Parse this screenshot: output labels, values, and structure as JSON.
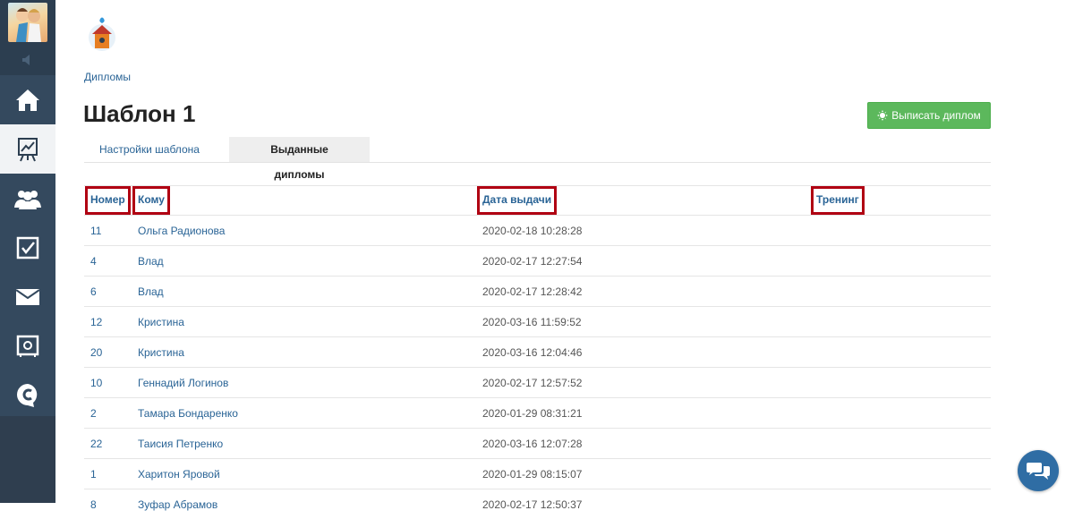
{
  "breadcrumb": "Дипломы",
  "page_title": "Шаблон 1",
  "issue_button_label": "Выписать диплом",
  "tabs": [
    {
      "label": "Настройки шаблона",
      "active": false
    },
    {
      "label": "Выданные дипломы",
      "active": true
    }
  ],
  "table": {
    "headers": [
      "Номер",
      "Кому",
      "Дата выдачи",
      "Тренинг"
    ],
    "rows": [
      {
        "num": "11",
        "to": "Ольга Радионова",
        "date": "2020-02-18 10:28:28",
        "training": ""
      },
      {
        "num": "4",
        "to": "Влад",
        "date": "2020-02-17 12:27:54",
        "training": ""
      },
      {
        "num": "6",
        "to": "Влад",
        "date": "2020-02-17 12:28:42",
        "training": ""
      },
      {
        "num": "12",
        "to": "Кристина",
        "date": "2020-03-16 11:59:52",
        "training": ""
      },
      {
        "num": "20",
        "to": "Кристина",
        "date": "2020-03-16 12:04:46",
        "training": ""
      },
      {
        "num": "10",
        "to": "Геннадий Логинов",
        "date": "2020-02-17 12:57:52",
        "training": ""
      },
      {
        "num": "2",
        "to": "Тамара Бондаренко",
        "date": "2020-01-29 08:31:21",
        "training": ""
      },
      {
        "num": "22",
        "to": "Таисия Петренко",
        "date": "2020-03-16 12:07:28",
        "training": ""
      },
      {
        "num": "1",
        "to": "Харитон Яровой",
        "date": "2020-01-29 08:15:07",
        "training": ""
      },
      {
        "num": "8",
        "to": "Зуфар Абрамов",
        "date": "2020-02-17 12:50:37",
        "training": ""
      }
    ]
  },
  "sidebar": {
    "items": [
      {
        "icon": "home-icon",
        "active": false
      },
      {
        "icon": "presentation-chart-icon",
        "active": true
      },
      {
        "icon": "users-icon",
        "active": false
      },
      {
        "icon": "checkbox-icon",
        "active": false
      },
      {
        "icon": "envelope-icon",
        "active": false
      },
      {
        "icon": "safe-icon",
        "active": false
      },
      {
        "icon": "copyright-chat-icon",
        "active": false
      }
    ]
  },
  "colors": {
    "sidebar_bg": "#2c3e50",
    "link": "#2a6496",
    "button_green": "#5cb85c",
    "highlight_box": "#b00012",
    "chat_button": "#2f6da4"
  }
}
